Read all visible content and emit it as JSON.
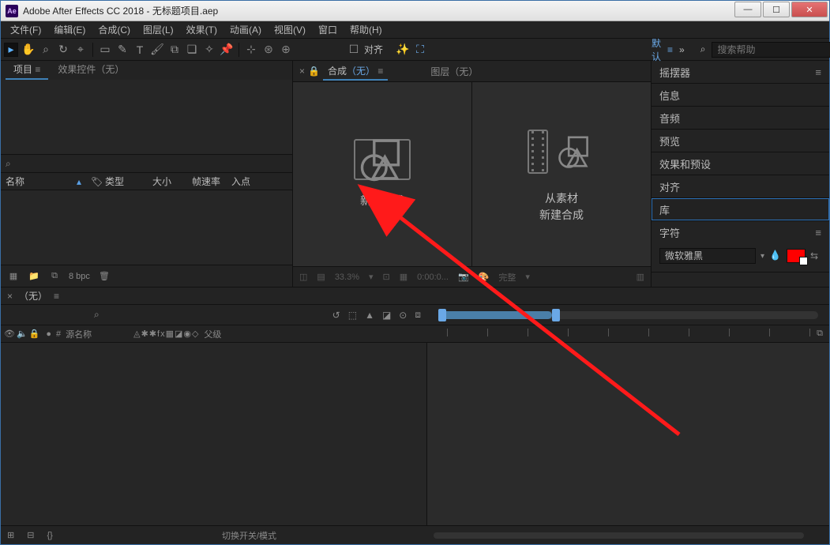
{
  "title": "Adobe After Effects CC 2018 - 无标题项目.aep",
  "ae_logo": "Ae",
  "menu": [
    "文件(F)",
    "编辑(E)",
    "合成(C)",
    "图层(L)",
    "效果(T)",
    "动画(A)",
    "视图(V)",
    "窗口",
    "帮助(H)"
  ],
  "toolbar": {
    "align": "对齐",
    "workspace": "默认",
    "search_placeholder": "搜索帮助"
  },
  "project": {
    "tab_project": "项目",
    "tab_effects": "效果控件（无）",
    "search_icon": "⌕",
    "col_name": "名称",
    "col_type": "类型",
    "col_size": "大小",
    "col_fps": "帧速率",
    "col_in": "入点",
    "bpc": "8 bpc"
  },
  "comp": {
    "lock": "🔒",
    "tab_comp": "合成",
    "tab_comp_none": "（无）",
    "tab_layer": "图层（无）",
    "new_comp": "新建合成",
    "from_footage_l1": "从素材",
    "from_footage_l2": "新建合成",
    "zoom": "33.3%",
    "time": "0:00:0...",
    "full": "完整"
  },
  "right_panels": [
    "摇摆器",
    "信息",
    "音频",
    "预览",
    "效果和预设",
    "对齐",
    "库",
    "字符"
  ],
  "char": {
    "font": "微软雅黑"
  },
  "timeline": {
    "tab": "（无）",
    "search": "⌕",
    "col_src": "源名称",
    "col_parent": "父级",
    "icon_string": "●◐◑▦◇◈◉",
    "switches": "◬◬◬ fx▦◪◉◇",
    "footer_switch": "切换开关/模式"
  }
}
